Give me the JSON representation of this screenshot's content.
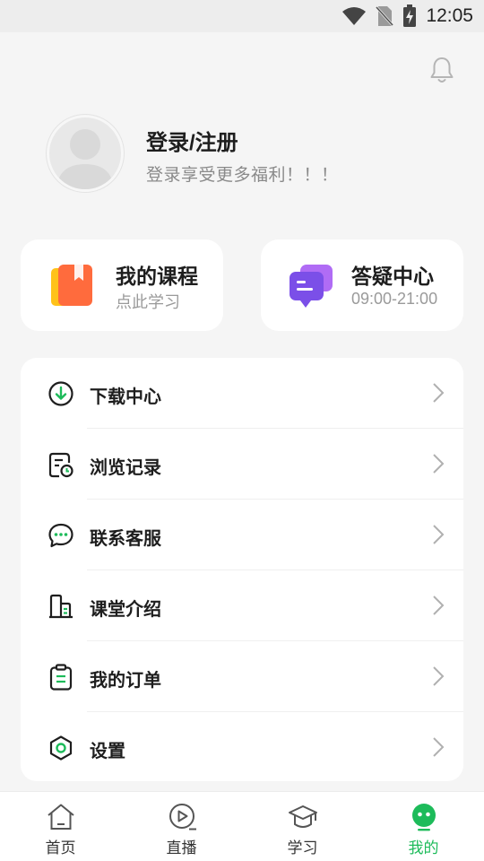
{
  "status_bar": {
    "time": "12:05",
    "icons": [
      "wifi-icon",
      "no-sim-icon",
      "battery-charging-icon"
    ]
  },
  "header": {
    "notification_icon": "bell-icon"
  },
  "profile": {
    "avatar_icon": "default-avatar-icon",
    "login_title": "登录/注册",
    "login_subtitle": "登录享受更多福利！！！"
  },
  "cards": [
    {
      "icon": "course-book-icon",
      "title": "我的课程",
      "subtitle": "点此学习"
    },
    {
      "icon": "chat-bubbles-icon",
      "title": "答疑中心",
      "subtitle": "09:00-21:00"
    }
  ],
  "menu": {
    "items": [
      {
        "icon": "download-icon",
        "label": "下载中心"
      },
      {
        "icon": "history-icon",
        "label": "浏览记录"
      },
      {
        "icon": "customer-service-icon",
        "label": "联系客服"
      },
      {
        "icon": "building-icon",
        "label": "课堂介绍"
      },
      {
        "icon": "order-icon",
        "label": "我的订单"
      },
      {
        "icon": "settings-icon",
        "label": "设置"
      }
    ]
  },
  "tab_bar": {
    "tabs": [
      {
        "icon": "home-icon",
        "label": "首页",
        "active": false
      },
      {
        "icon": "live-play-icon",
        "label": "直播",
        "active": false
      },
      {
        "icon": "graduation-cap-icon",
        "label": "学习",
        "active": false
      },
      {
        "icon": "mine-face-icon",
        "label": "我的",
        "active": true
      }
    ]
  },
  "colors": {
    "accent": "#1dbb5a",
    "background": "#f5f5f5",
    "card": "#ffffff"
  }
}
